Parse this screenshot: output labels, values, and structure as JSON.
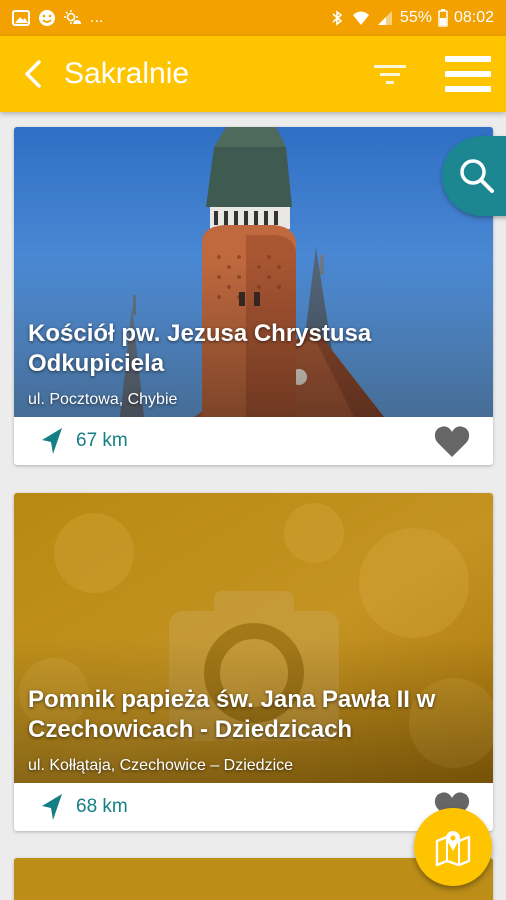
{
  "status_bar": {
    "dots": "...",
    "battery": "55%",
    "time": "08:02"
  },
  "app_bar": {
    "title": "Sakralnie"
  },
  "cards": [
    {
      "title": "Kościół pw. Jezusa Chrystusa Odkupiciela",
      "address": "ul. Pocztowa, Chybie",
      "distance": "67 km"
    },
    {
      "title": "Pomnik papieża św. Jana Pawła II w Czechowicach - Dziedzicach",
      "address": "ul. Kołłątaja, Czechowice – Dziedzice",
      "distance": "68 km"
    }
  ],
  "colors": {
    "status_bar": "#f2a100",
    "app_bar": "#ffc400",
    "accent_teal": "#1d8791",
    "distance_text": "#157f86",
    "favorite_icon": "#666666"
  },
  "icons": {
    "back": "arrow-back-icon",
    "filter": "filter-icon",
    "menu": "hamburger-menu-icon",
    "search": "search-icon",
    "distance": "navigation-arrow-icon",
    "favorite": "heart-icon",
    "map": "map-pin-icon"
  }
}
